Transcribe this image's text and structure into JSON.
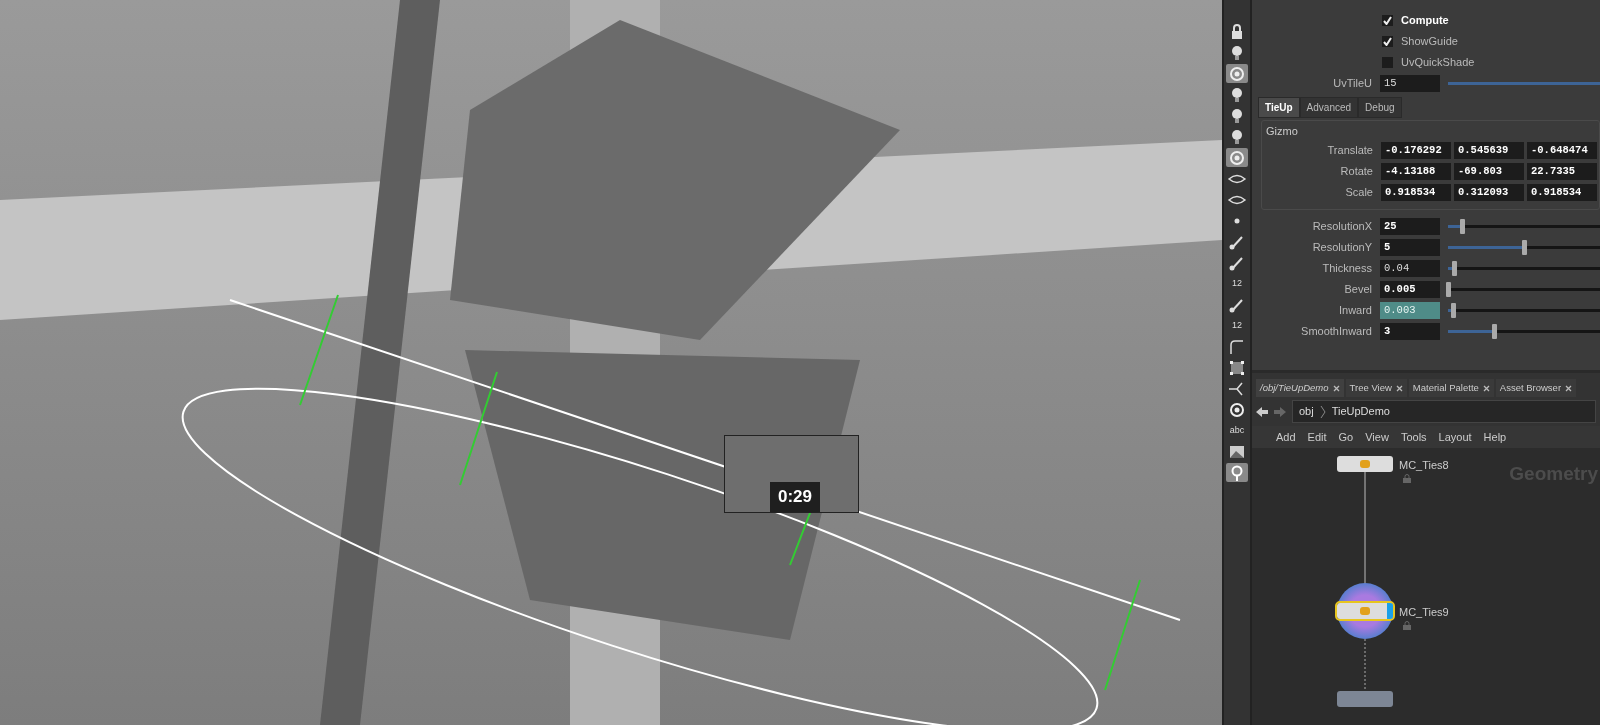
{
  "viewport": {
    "thumbnail": {
      "timestamp": "0:29"
    }
  },
  "toolbar": [
    {
      "kind": "lock",
      "selected": false
    },
    {
      "kind": "bulb",
      "selected": false
    },
    {
      "kind": "lens",
      "selected": true
    },
    {
      "kind": "bulb",
      "selected": false
    },
    {
      "kind": "bulb",
      "selected": false
    },
    {
      "kind": "bulb",
      "selected": false
    },
    {
      "kind": "lens",
      "selected": true
    },
    {
      "kind": "eye",
      "selected": false
    },
    {
      "kind": "eye",
      "selected": false
    },
    {
      "kind": "dot",
      "selected": false
    },
    {
      "kind": "brush",
      "selected": false
    },
    {
      "kind": "brush",
      "selected": false
    },
    {
      "kind": "text",
      "label": "12",
      "selected": false
    },
    {
      "kind": "brush",
      "selected": false
    },
    {
      "kind": "text",
      "label": "12",
      "selected": false
    },
    {
      "kind": "corner",
      "selected": false
    },
    {
      "kind": "grid",
      "selected": false
    },
    {
      "kind": "branch",
      "selected": false
    },
    {
      "kind": "lens",
      "selected": false
    },
    {
      "kind": "text",
      "label": "abc",
      "selected": false
    },
    {
      "kind": "picture",
      "selected": false
    },
    {
      "kind": "pin",
      "selected": true
    }
  ],
  "parameters": {
    "toggles": [
      {
        "label": "Compute",
        "checked": true,
        "modified": true
      },
      {
        "label": "ShowGuide",
        "checked": true,
        "modified": false
      },
      {
        "label": "UvQuickShade",
        "checked": false,
        "modified": false
      }
    ],
    "uv_tile_u": {
      "label": "UvTileU",
      "value": "15",
      "level": 1
    },
    "tabs": [
      {
        "label": "TieUp",
        "selected": true
      },
      {
        "label": "Advanced",
        "selected": false
      },
      {
        "label": "Debug",
        "selected": false
      }
    ],
    "gizmo": {
      "title": "Gizmo",
      "rows": [
        {
          "label": "Translate",
          "values": [
            "-0.176292",
            "0.545639",
            "-0.648474"
          ]
        },
        {
          "label": "Rotate",
          "values": [
            "-4.13188",
            "-69.803",
            "22.7335"
          ]
        },
        {
          "label": "Scale",
          "values": [
            "0.918534",
            "0.312093",
            "0.918534"
          ]
        }
      ]
    },
    "fields": [
      {
        "label": "ResolutionX",
        "value": "25",
        "level": 0.09,
        "modified": true,
        "highlighted": false
      },
      {
        "label": "ResolutionY",
        "value": "5",
        "level": 0.5,
        "modified": true,
        "highlighted": false
      },
      {
        "label": "Thickness",
        "value": "0.04",
        "level": 0.04,
        "modified": false,
        "highlighted": false
      },
      {
        "label": "Bevel",
        "value": "0.005",
        "level": 0,
        "modified": true,
        "highlighted": false
      },
      {
        "label": "Inward",
        "value": "0.003",
        "level": 0.03,
        "modified": false,
        "highlighted": true
      },
      {
        "label": "SmoothInward",
        "value": "3",
        "level": 0.3,
        "modified": true,
        "highlighted": false
      }
    ]
  },
  "network": {
    "tabs": [
      {
        "label": "/obj/TieUpDemo",
        "selected": true
      },
      {
        "label": "Tree View",
        "selected": false
      },
      {
        "label": "Material Palette",
        "selected": false
      },
      {
        "label": "Asset Browser",
        "selected": false
      }
    ],
    "path": [
      "obj",
      "TieUpDemo"
    ],
    "menu": [
      "Add",
      "Edit",
      "Go",
      "View",
      "Tools",
      "Layout",
      "Help"
    ],
    "context_label": "Geometry",
    "nodes": [
      {
        "name": "MC_Ties8",
        "selected": false,
        "display_flag": false
      },
      {
        "name": "MC_Ties9",
        "selected": true,
        "display_flag": true
      },
      {
        "selected": false,
        "display_flag": false
      }
    ]
  }
}
